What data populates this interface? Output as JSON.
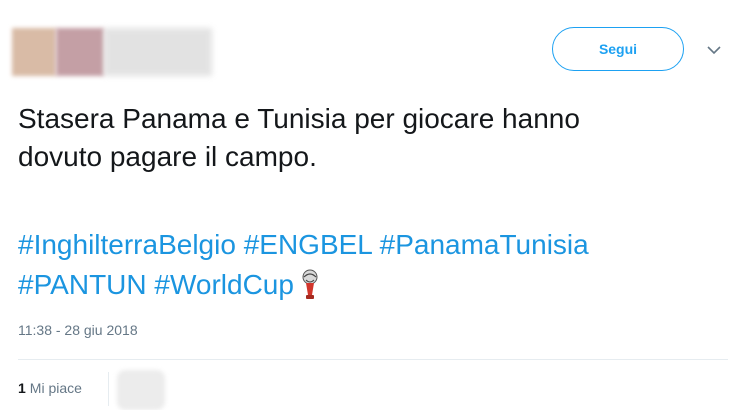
{
  "header": {
    "follow_label": "Segui",
    "caret_icon": "chevron-down-icon"
  },
  "tweet": {
    "text_lines": [
      "Stasera Panama e Tunisia per giocare hanno",
      "dovuto pagare il campo."
    ],
    "hashtags": [
      "#InghilterraBelgio",
      "#ENGBEL",
      "#PanamaTunisia",
      "#PANTUN",
      "#WorldCup"
    ],
    "emoji_icon": "world-cup-trophy-icon",
    "timestamp": "11:38 - 28 giu 2018"
  },
  "engagement": {
    "likes_count": "1",
    "likes_label": "Mi piace"
  },
  "colors": {
    "link": "#1b95e0",
    "follow_border": "#1da1f2",
    "meta_text": "#657786"
  }
}
